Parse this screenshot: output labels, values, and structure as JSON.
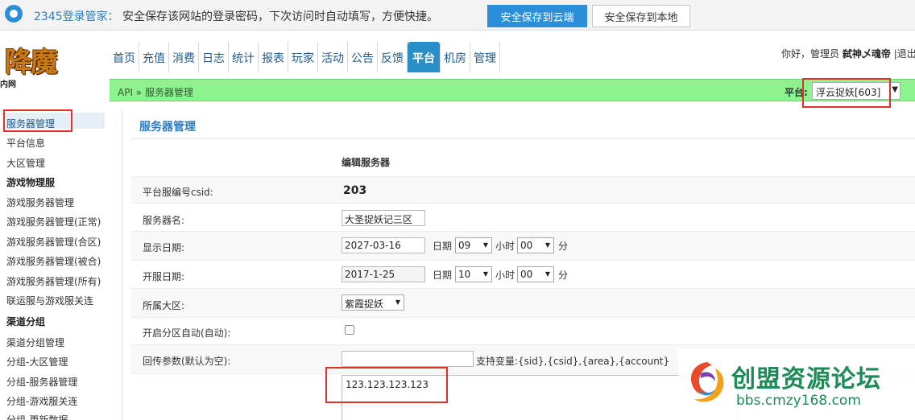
{
  "password_manager": {
    "title": "2345登录管家：",
    "message": "安全保存该网站的登录密码，下次访问时自动填写，方便快捷。",
    "save_cloud": "安全保存到云端",
    "save_local": "安全保存到本地"
  },
  "logo": {
    "text": "降魔",
    "sub": "内网"
  },
  "nav": {
    "items": [
      "首页",
      "充值",
      "消费",
      "日志",
      "统计",
      "报表",
      "玩家",
      "活动",
      "公告",
      "反馈",
      "平台",
      "机房",
      "管理"
    ],
    "active": "平台"
  },
  "user": {
    "greeting": "你好，管理员",
    "name": "弑神乄魂帝",
    "logout": "|退出"
  },
  "breadcrumb": {
    "text": "API » 服务器管理",
    "platform_label": "平台:",
    "platform_value": "浮云捉妖[603]"
  },
  "sidebar": {
    "items": [
      {
        "label": "服务器管理",
        "group": false
      },
      {
        "label": "平台信息",
        "group": false
      },
      {
        "label": "大区管理",
        "group": false
      },
      {
        "label": "游戏物理服",
        "group": true
      },
      {
        "label": "游戏服务器管理",
        "group": false
      },
      {
        "label": "游戏服务器管理(正常)",
        "group": false
      },
      {
        "label": "游戏服务器管理(合区)",
        "group": false
      },
      {
        "label": "游戏服务器管理(被合)",
        "group": false
      },
      {
        "label": "游戏服务器管理(所有)",
        "group": false
      },
      {
        "label": "联运服与游戏服关连",
        "group": false
      },
      {
        "label": "渠道分组",
        "group": true
      },
      {
        "label": "渠道分组管理",
        "group": false
      },
      {
        "label": "分组-大区管理",
        "group": false
      },
      {
        "label": "分组-服务器管理",
        "group": false
      },
      {
        "label": "分组-游戏服关连",
        "group": false
      },
      {
        "label": "分组-更新数据",
        "group": false
      }
    ]
  },
  "main": {
    "title": "服务器管理",
    "form_heading": "编辑服务器",
    "csid_label": "平台服编号csid:",
    "csid_value": "203",
    "name_label": "服务器名:",
    "name_value": "大圣捉妖记三区",
    "show_date_label": "显示日期:",
    "show_date": "2027-03-16",
    "show_hour": "09",
    "show_minute": "00",
    "open_date_label": "开服日期:",
    "open_date": "2017-1-25",
    "open_hour": "10",
    "open_minute": "00",
    "unit_date": "日期",
    "unit_hour": "小时",
    "unit_minute": "分",
    "area_label": "所属大区:",
    "area_value": "紫霞捉妖",
    "auto_label": "开启分区自动(自动):",
    "callback_label": "回传参数(默认为空):",
    "callback_hint": "支持变量:{sid},{csid},{area},{account}",
    "ip_value": "123.123.123.123"
  },
  "watermark": {
    "title": "创盟资源论坛",
    "url": "bbs.cmzy168.com"
  }
}
